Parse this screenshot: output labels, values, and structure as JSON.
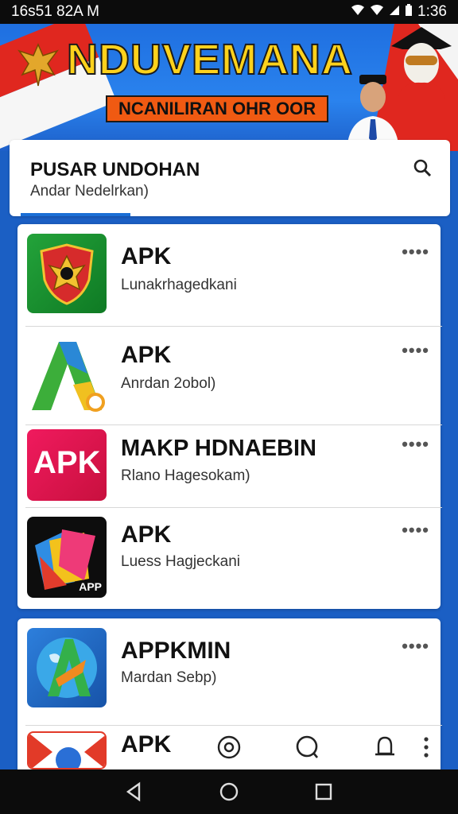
{
  "status_bar": {
    "left_text": "16s51 82A M",
    "time": "1:36"
  },
  "banner": {
    "title": "NDUVEMANA",
    "subtitle": "NCANILIRAN OHR OOR"
  },
  "header": {
    "title": "PUSAR UNDOHAN",
    "subtitle": "Andar Nedelrkan)"
  },
  "apps": [
    {
      "name": "APK",
      "subtitle": "Lunakrhagedkani",
      "icon": "emblem-shield-icon"
    },
    {
      "name": "APK",
      "subtitle": "Anrdan 2obol)",
      "icon": "letter-a-icon"
    },
    {
      "name": "MAKP HDNAEBIN",
      "subtitle": "Rlano Hagesokam)",
      "icon": "apk-text-icon"
    },
    {
      "name": "APK",
      "subtitle": "Luess Hagjeckani",
      "icon": "app-cards-icon"
    },
    {
      "name": "APPKMIN",
      "subtitle": "Mardan Sebp)",
      "icon": "map-a-icon"
    },
    {
      "name": "APK",
      "subtitle": "",
      "icon": "red-circle-app-icon"
    }
  ],
  "more_label": "••••",
  "app_badge_text": "APP",
  "apk_badge_text": "APK",
  "bottom_tabs": [
    "compass-icon",
    "chat-icon",
    "bell-icon",
    "more-vertical-icon"
  ],
  "colors": {
    "banner_blue": "#2a83ee",
    "title_yellow": "#ffd21c",
    "sub_orange": "#f05a12",
    "accent_blue": "#1b6fd6"
  }
}
